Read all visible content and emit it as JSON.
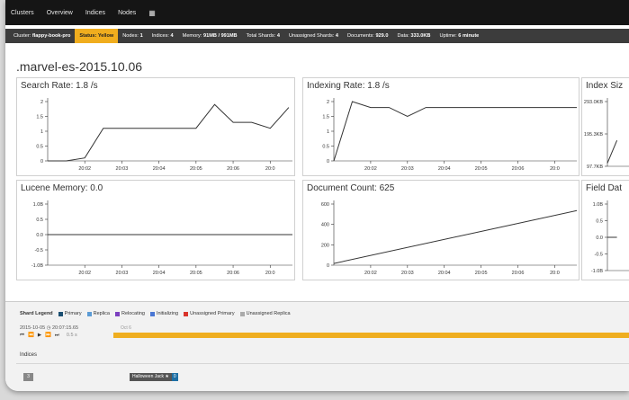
{
  "nav": {
    "items": [
      "Clusters",
      "Overview",
      "Indices",
      "Nodes"
    ],
    "grid_icon": "▦"
  },
  "status": {
    "items": [
      {
        "label": "Cluster:",
        "value": "flappy-book-pro",
        "highlight": false
      },
      {
        "label": "Status:",
        "value": "Yellow",
        "highlight": true
      },
      {
        "label": "Nodes:",
        "value": "1",
        "highlight": false
      },
      {
        "label": "Indices:",
        "value": "4",
        "highlight": false
      },
      {
        "label": "Memory:",
        "value": "91MB / 991MB",
        "highlight": false
      },
      {
        "label": "Total Shards:",
        "value": "4",
        "highlight": false
      },
      {
        "label": "Unassigned Shards:",
        "value": "4",
        "highlight": false
      },
      {
        "label": "Documents:",
        "value": "929.0",
        "highlight": false
      },
      {
        "label": "Data:",
        "value": "333.0KB",
        "highlight": false
      },
      {
        "label": "Uptime:",
        "value": "6 minute",
        "highlight": false
      }
    ]
  },
  "page_title": ".marvel-es-2015.10.06",
  "chart_data": [
    {
      "id": "search-rate",
      "type": "line",
      "title": "Search Rate: 1.8 /s",
      "y_ticks": [
        "2",
        "1.5",
        "1",
        "0.5",
        "0"
      ],
      "ylim": [
        0,
        2
      ],
      "x_ticks": [
        "20:02",
        "20:03",
        "20:04",
        "20:05",
        "20:06",
        "20:0"
      ],
      "x": [
        0,
        0.5,
        1,
        1.5,
        2,
        3,
        4,
        4.5,
        5,
        5.5,
        6,
        6.5
      ],
      "values": [
        0,
        0,
        0.1,
        1.1,
        1.1,
        1.1,
        1.1,
        1.9,
        1.3,
        1.3,
        1.1,
        1.8
      ]
    },
    {
      "id": "indexing-rate",
      "type": "line",
      "title": "Indexing Rate: 1.8 /s",
      "y_ticks": [
        "2",
        "1.5",
        "1",
        "0.5",
        "0"
      ],
      "ylim": [
        0,
        2
      ],
      "x_ticks": [
        "20:02",
        "20:03",
        "20:04",
        "20:05",
        "20:06",
        "20:0"
      ],
      "x": [
        0,
        0.5,
        1,
        1.5,
        2,
        2.5,
        6.6
      ],
      "values": [
        0,
        2,
        1.8,
        1.8,
        1.5,
        1.8,
        1.8
      ]
    },
    {
      "id": "index-size",
      "type": "line",
      "title": "Index Siz",
      "y_ticks": [
        "293.0KB",
        "195.3KB",
        "97.7KB"
      ],
      "ylim": [
        0,
        1
      ],
      "x_ticks": [],
      "x": [
        0,
        0.5
      ],
      "values": [
        0.05,
        0.4
      ]
    },
    {
      "id": "lucene-memory",
      "type": "line",
      "title": "Lucene Memory: 0.0",
      "y_ticks": [
        "1.0B",
        "0.5",
        "0.0",
        "-0.5",
        "-1.0B"
      ],
      "ylim": [
        -1,
        1
      ],
      "x_ticks": [
        "20:02",
        "20:03",
        "20:04",
        "20:05",
        "20:06",
        "20:0"
      ],
      "x": [
        0,
        6.6
      ],
      "values": [
        0,
        0
      ]
    },
    {
      "id": "document-count",
      "type": "line",
      "title": "Document Count: 625",
      "y_ticks": [
        "600",
        "400",
        "200",
        "0"
      ],
      "ylim": [
        0,
        700
      ],
      "x_ticks": [
        "20:02",
        "20:03",
        "20:04",
        "20:05",
        "20:06",
        "20:0"
      ],
      "x": [
        0,
        6.6
      ],
      "values": [
        20,
        625
      ]
    },
    {
      "id": "field-data",
      "type": "line",
      "title": "Field Dat",
      "y_ticks": [
        "1.0B",
        "0.5",
        "0.0",
        "-0.5",
        "-1.0B"
      ],
      "ylim": [
        -1,
        1
      ],
      "x_ticks": [],
      "x": [
        0,
        0.5
      ],
      "values": [
        0,
        0
      ]
    }
  ],
  "legend": {
    "label": "Shard Legend",
    "entries": [
      {
        "name": "Primary",
        "color": "#1b4f72"
      },
      {
        "name": "Replica",
        "color": "#5b9bd5"
      },
      {
        "name": "Relocating",
        "color": "#7b3fbf"
      },
      {
        "name": "Initializing",
        "color": "#4a77d4"
      },
      {
        "name": "Unassigned Primary",
        "color": "#d9342b"
      },
      {
        "name": "Unassigned Replica",
        "color": "#aaaaaa"
      }
    ]
  },
  "timeline": {
    "timestamp": "2015-10-05 ◷ 20:07:15.65",
    "tick": "Oct 6",
    "controls": [
      "⏮",
      "⏪",
      "▶",
      "⏩",
      "⏭"
    ],
    "speed": "0.5 s"
  },
  "indices": {
    "label": "Indices",
    "node_box": "3",
    "chip_name": "Halloween Jack ★",
    "chip_count": "0"
  }
}
